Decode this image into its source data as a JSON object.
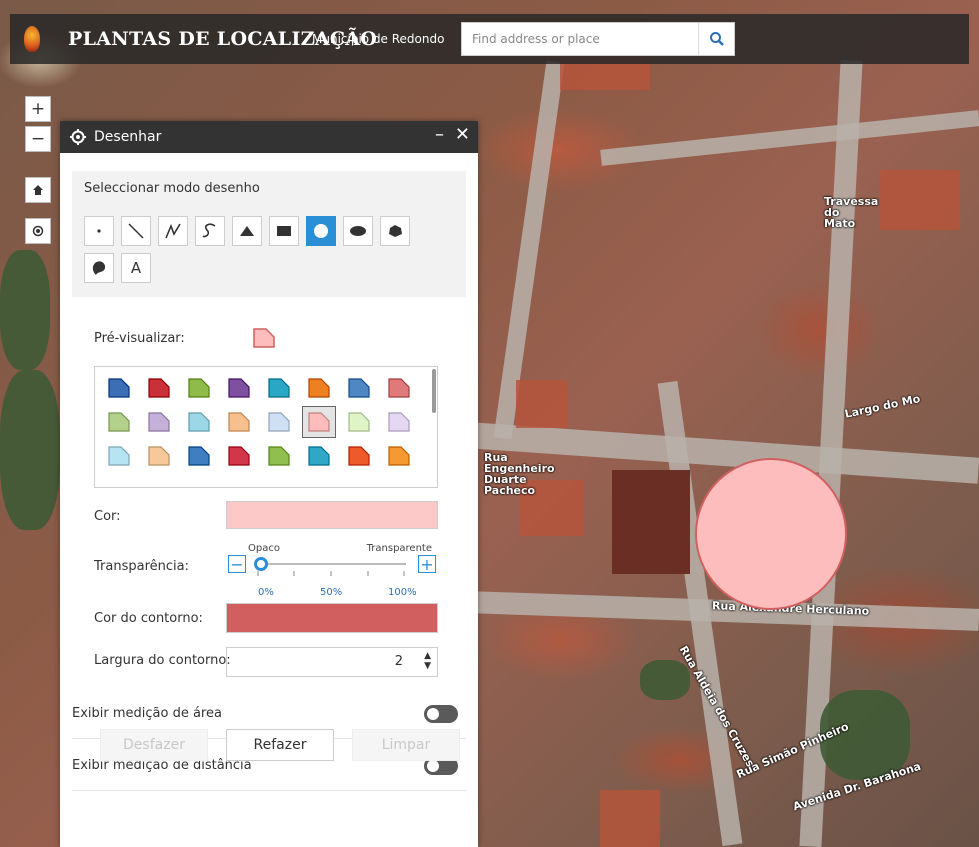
{
  "header": {
    "title": "PLANTAS DE LOCALIZAÇÃO",
    "subtitle": "Município de Redondo",
    "search_placeholder": "Find address or place"
  },
  "map_tools": {
    "zoom_in": "+",
    "zoom_out": "−"
  },
  "map_labels": {
    "street_1": "Rua Engenheiro Duarte Pacheco",
    "street_2": "Rua Alexandre Herculano",
    "street_3": "Largo do Mo",
    "street_4": "Travessa do Mato",
    "street_5": "Rua Aldeia dos Cruzes",
    "street_6": "Avenida Dr. Barahona",
    "street_7": "Rua Simão Pinheiro"
  },
  "panel": {
    "title": "Desenhar",
    "minimize": "–",
    "close": "✕",
    "mode_title": "Seleccionar modo desenho",
    "mode_text_label": "A",
    "preview_label": "Pré-visualizar:",
    "color_label": "Cor:",
    "fill_color": "#fdc8c8",
    "transparency_label": "Transparência:",
    "slider_left": "Opaco",
    "slider_right": "Transparente",
    "slider_value": 0,
    "tick_0": "0%",
    "tick_50": "50%",
    "tick_100": "100%",
    "outline_color_label": "Cor do contorno:",
    "outline_color": "#d25f5f",
    "outline_width_label": "Largura do contorno:",
    "outline_width_value": "2",
    "area_toggle_label": "Exibir medição de área",
    "distance_toggle_label": "Exibir medição de distância",
    "undo_label": "Desfazer",
    "redo_label": "Refazer",
    "clear_label": "Limpar"
  },
  "symbol_palette": [
    [
      "#3a6fb5",
      "#c9303a",
      "#8fbb4a",
      "#7f4fa0",
      "#2aa7c4",
      "#ee8022",
      "#4f86c4",
      "#e07a7a"
    ],
    [
      "#b4d18c",
      "#c4b0d8",
      "#9bd7e6",
      "#f6c08e",
      "#cfe0f4",
      "#fdbdbd",
      "#dff4c6",
      "#e4d8f2"
    ],
    [
      "#b7e4f2",
      "#f7c99a",
      "#3f7fc1",
      "#d2364a",
      "#90bf50",
      "#2fa8c8",
      "#ee5a2a",
      "#f59a30"
    ]
  ]
}
